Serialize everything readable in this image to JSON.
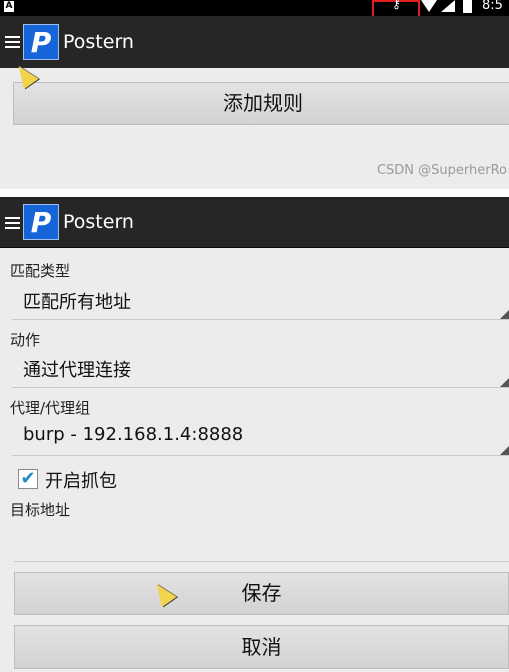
{
  "status_bar": {
    "indicator": "A",
    "vpn_icon": "key-icon",
    "time": "8:5"
  },
  "top_screen": {
    "app_title": "Postern",
    "app_logo": "P",
    "add_rule_label": "添加规则",
    "watermark": "CSDN @SuperherRo"
  },
  "editor": {
    "app_title": "Postern",
    "app_logo": "P",
    "match_type_label": "匹配类型",
    "match_type_value": "匹配所有地址",
    "action_label": "动作",
    "action_value": "通过代理连接",
    "proxy_label": "代理/代理组",
    "proxy_value": "burp - 192.168.1.4:8888",
    "capture_label": "开启抓包",
    "capture_checked": true,
    "target_label": "目标地址",
    "target_value": "",
    "save_label": "保存",
    "cancel_label": "取消"
  },
  "colors": {
    "action_bar": "#262626",
    "logo_blue": "#1565d8",
    "checkbox_accent": "#1e88c8",
    "highlight_red": "#e02020"
  }
}
